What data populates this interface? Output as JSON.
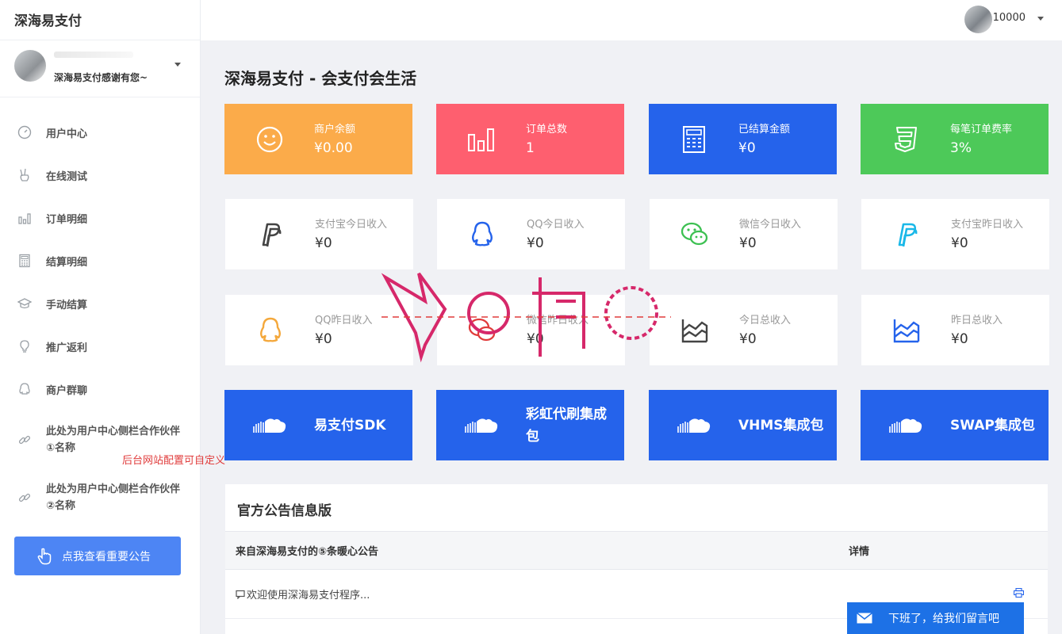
{
  "brand": "深海易支付",
  "profile": {
    "motto": "深海易支付感谢有您~"
  },
  "header": {
    "username": "10000"
  },
  "nav": [
    {
      "label": "用户中心",
      "icon": "dashboard-icon"
    },
    {
      "label": "在线测试",
      "icon": "hand-peace-icon"
    },
    {
      "label": "订单明细",
      "icon": "bar-chart-icon"
    },
    {
      "label": "结算明细",
      "icon": "calculator-icon"
    },
    {
      "label": "手动结算",
      "icon": "graduation-cap-icon"
    },
    {
      "label": "推广返利",
      "icon": "lightbulb-icon"
    },
    {
      "label": "商户群聊",
      "icon": "qq-icon"
    }
  ],
  "partners": [
    {
      "label": "此处为用户中心侧栏合作伙伴①名称",
      "icon": "link-icon"
    },
    {
      "label": "此处为用户中心侧栏合作伙伴②名称",
      "icon": "link-icon"
    }
  ],
  "sidebar_note": "后台网站配置可自定义",
  "notice_button": "点我查看重要公告",
  "page_title": "深海易支付 - 会支付会生活",
  "stats_solid": [
    {
      "label": "商户余额",
      "value": "¥0.00",
      "color": "#fbab4a",
      "icon": "smile-icon"
    },
    {
      "label": "订单总数",
      "value": "1",
      "color": "#fe5f6f",
      "icon": "bar-chart-icon"
    },
    {
      "label": "已结算金额",
      "value": "¥0",
      "color": "#2563eb",
      "icon": "calculator-icon"
    },
    {
      "label": "每笔订单费率",
      "value": "3%",
      "color": "#4dc959",
      "icon": "css3-icon"
    }
  ],
  "stats_today": [
    {
      "label": "支付宝今日收入",
      "value": "¥0",
      "icon": "paypal-icon",
      "icon_color": "#444444"
    },
    {
      "label": "QQ今日收入",
      "value": "¥0",
      "icon": "qq-icon",
      "icon_color": "#2563eb"
    },
    {
      "label": "微信今日收入",
      "value": "¥0",
      "icon": "wechat-icon",
      "icon_color": "#3cc051"
    },
    {
      "label": "支付宝昨日收入",
      "value": "¥0",
      "icon": "paypal-icon",
      "icon_color": "#1ab8e8"
    }
  ],
  "stats_yesterday": [
    {
      "label": "QQ昨日收入",
      "value": "¥0",
      "icon": "qq-icon",
      "icon_color": "#f4a83c"
    },
    {
      "label": "微信昨日收入",
      "value": "¥0",
      "icon": "wechat-icon",
      "icon_color": "#e03b3b"
    },
    {
      "label": "今日总收入",
      "value": "¥0",
      "icon": "area-chart-icon",
      "icon_color": "#444444"
    },
    {
      "label": "昨日总收入",
      "value": "¥0",
      "icon": "area-chart-icon",
      "icon_color": "#2563eb"
    }
  ],
  "downloads": [
    {
      "label": "易支付SDK",
      "icon": "soundcloud-icon"
    },
    {
      "label": "彩虹代刷集成包",
      "icon": "soundcloud-icon"
    },
    {
      "label": "VHMS集成包",
      "icon": "soundcloud-icon"
    },
    {
      "label": "SWAP集成包",
      "icon": "soundcloud-icon"
    }
  ],
  "announcement": {
    "title": "官方公告信息版",
    "col_source": "来自深海易支付的⑤条暖心公告",
    "col_detail": "详情",
    "rows": [
      {
        "text": "欢迎使用深海易支付程序..."
      }
    ]
  },
  "message_button": "下班了，给我们留言吧",
  "colors": {
    "accent": "#2563eb",
    "sidebar_button": "#4d85f4"
  }
}
